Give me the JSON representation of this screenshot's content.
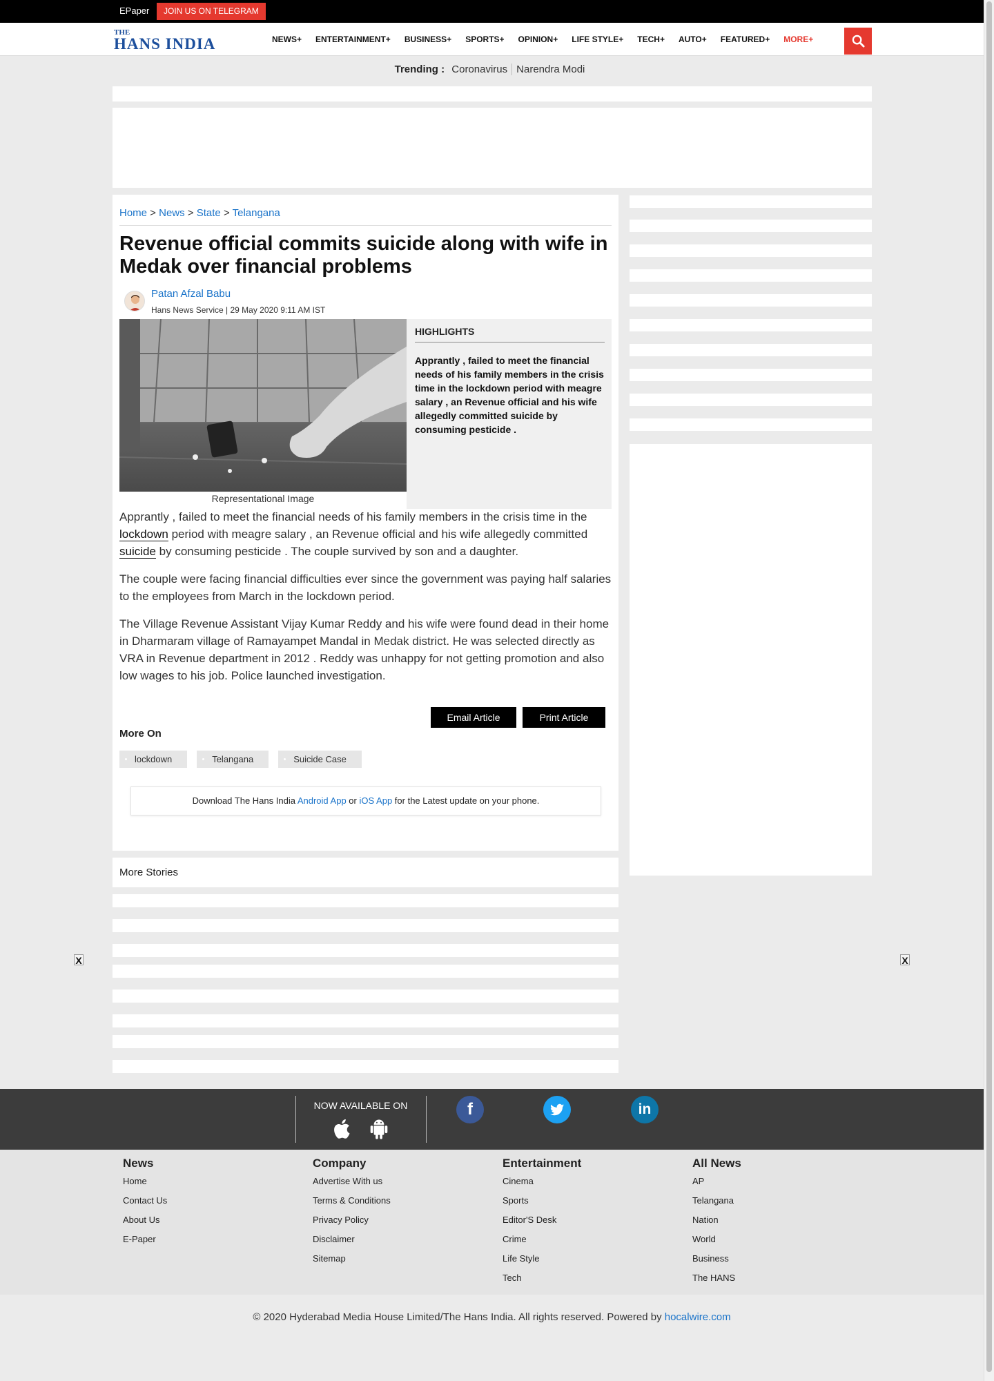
{
  "topbar": {
    "epaper": "EPaper",
    "telegram": "JOIN US ON TELEGRAM"
  },
  "logo": {
    "the": "THE",
    "main": "HANS INDIA"
  },
  "nav": {
    "items": [
      "NEWS",
      "ENTERTAINMENT",
      "BUSINESS",
      "SPORTS",
      "OPINION",
      "LIFE STYLE",
      "TECH",
      "AUTO",
      "FEATURED"
    ],
    "more": "MORE",
    "plus": "+"
  },
  "trending": {
    "label": "Trending :",
    "items": [
      "Coronavirus",
      "Narendra Modi"
    ]
  },
  "breadcrumb": {
    "home": "Home",
    "sep1": " > ",
    "news": "News",
    "sep2": " > ",
    "state": "State",
    "sep3": " > ",
    "telangana": "Telangana"
  },
  "article": {
    "title": "Revenue official commits suicide along with wife in Medak over financial problems",
    "author": "Patan Afzal Babu",
    "byline": "Hans News Service | 29 May 2020 9:11 AM IST",
    "image_caption": "Representational Image",
    "highlights_title": "HIGHLIGHTS",
    "highlights_text": "Apprantly , failed to meet the financial needs of his family members in the crisis time in the lockdown period with meagre salary , an Revenue official and his wife allegedly committed suicide by consuming pesticide .",
    "p1_a": "Apprantly , failed to meet the financial needs of his family members in the crisis time in the ",
    "p1_kw1": "lockdown",
    "p1_b": " period with meagre salary , an Revenue official and his wife allegedly committed ",
    "p1_kw2": "suicide",
    "p1_c": " by consuming pesticide . The couple survived by son and a daughter.",
    "p2": "The couple were facing financial difficulties ever since the government was paying half salaries to the employees from March in the lockdown period.",
    "p3": "The Village Revenue Assistant Vijay Kumar Reddy and his wife were found dead in their home in Dharmaram village of Ramayampet Mandal in Medak district. He was selected directly as VRA in Revenue department in 2012 . Reddy was unhappy for not getting promotion and also low wages to his job. Police launched investigation.",
    "email_btn": "Email Article",
    "print_btn": "Print Article",
    "more_on": "More On",
    "tags": [
      "lockdown",
      "Telangana",
      "Suicide Case"
    ],
    "download_a": "Download The Hans India ",
    "download_android": "Android App",
    "download_or": " or ",
    "download_ios": "iOS App",
    "download_b": " for the Latest update on your phone."
  },
  "more_stories": "More Stories",
  "close_label": "X",
  "footer": {
    "available": "NOW AVAILABLE ON",
    "fb": "f",
    "li": "in",
    "columns": [
      {
        "title": "News",
        "links": [
          "Home",
          "Contact Us",
          "About Us",
          "E-Paper"
        ]
      },
      {
        "title": "Company",
        "links": [
          "Advertise With us",
          "Terms & Conditions",
          "Privacy Policy",
          "Disclaimer",
          "Sitemap"
        ]
      },
      {
        "title": "Entertainment",
        "links": [
          "Cinema",
          "Sports",
          "Editor'S Desk",
          "Crime",
          "Life Style",
          "Tech"
        ]
      },
      {
        "title": "All News",
        "links": [
          "AP",
          "Telangana",
          "Nation",
          "World",
          "Business",
          "The HANS"
        ]
      }
    ],
    "copyright": "© 2020 Hyderabad Media House Limited/The Hans India. All rights reserved. Powered by ",
    "powered": "hocalwire.com"
  },
  "colors": {
    "accent": "#e5392f",
    "link": "#1a73c9",
    "footer_dark": "#3c3c3c",
    "brand_blue": "#1d4f9c"
  }
}
